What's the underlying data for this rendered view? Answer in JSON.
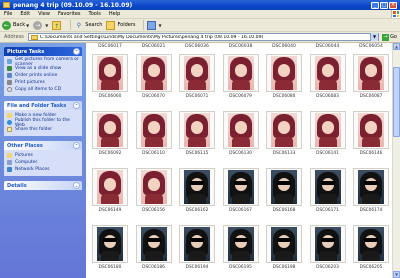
{
  "window": {
    "title": "penang 4 trip (09.10.09 - 16.10.09)",
    "controls": [
      "_",
      "□",
      "×"
    ]
  },
  "menu": [
    "File",
    "Edit",
    "View",
    "Favorites",
    "Tools",
    "Help"
  ],
  "toolbar": {
    "back": "Back",
    "forward": "",
    "search": "Search",
    "folders": "Folders",
    "views": ""
  },
  "address": {
    "label": "Address",
    "path": "C:\\Documents and Settings\\Linds\\My Documents\\My Pictures\\penang 4 trip (09.10.09 - 16.10.09)",
    "go": "Go"
  },
  "sidebar": {
    "picture_tasks": {
      "title": "Picture Tasks",
      "items": [
        "Get pictures from camera or scanner",
        "View as a slide show",
        "Order prints online",
        "Print pictures",
        "Copy all items to CD"
      ]
    },
    "file_folder_tasks": {
      "title": "File and Folder Tasks",
      "items": [
        "Make a new folder",
        "Publish this folder to the Web",
        "Share this folder"
      ]
    },
    "other_places": {
      "title": "Other Places",
      "items": [
        "Pictures",
        "Computer",
        "Network Places"
      ]
    },
    "details": {
      "title": "Details"
    }
  },
  "files": {
    "top_row": [
      "DSC06017",
      "DSC06021",
      "DSC06036",
      "DSC06038",
      "DSC06040",
      "DSC06044",
      "DSC06054"
    ],
    "rows": [
      [
        {
          "name": "DSC06060",
          "style": "pink"
        },
        {
          "name": "DSC06070",
          "style": "pink"
        },
        {
          "name": "DSC06071",
          "style": "pink"
        },
        {
          "name": "DSC06079",
          "style": "pink"
        },
        {
          "name": "DSC06080",
          "style": "pink"
        },
        {
          "name": "DSC06083",
          "style": "pink"
        },
        {
          "name": "DSC06087",
          "style": "pink"
        }
      ],
      [
        {
          "name": "DSC06092",
          "style": "pink"
        },
        {
          "name": "DSC06110",
          "style": "pink"
        },
        {
          "name": "DSC06115",
          "style": "pink"
        },
        {
          "name": "DSC06130",
          "style": "pink"
        },
        {
          "name": "DSC06133",
          "style": "pink"
        },
        {
          "name": "DSC06141",
          "style": "pink"
        },
        {
          "name": "DSC06146",
          "style": "pink"
        }
      ],
      [
        {
          "name": "DSC06149",
          "style": "pink"
        },
        {
          "name": "DSC06156",
          "style": "pink"
        },
        {
          "name": "DSC06162",
          "style": "car"
        },
        {
          "name": "DSC06167",
          "style": "car"
        },
        {
          "name": "DSC06168",
          "style": "car"
        },
        {
          "name": "DSC06171",
          "style": "car"
        },
        {
          "name": "DSC06174",
          "style": "car"
        }
      ],
      [
        {
          "name": "DSC06180",
          "style": "car"
        },
        {
          "name": "DSC06186",
          "style": "car"
        },
        {
          "name": "DSC06194",
          "style": "car"
        },
        {
          "name": "DSC06195",
          "style": "car"
        },
        {
          "name": "DSC06198",
          "style": "car"
        },
        {
          "name": "DSC06203",
          "style": "car"
        },
        {
          "name": "DSC06205",
          "style": "car"
        }
      ]
    ]
  }
}
